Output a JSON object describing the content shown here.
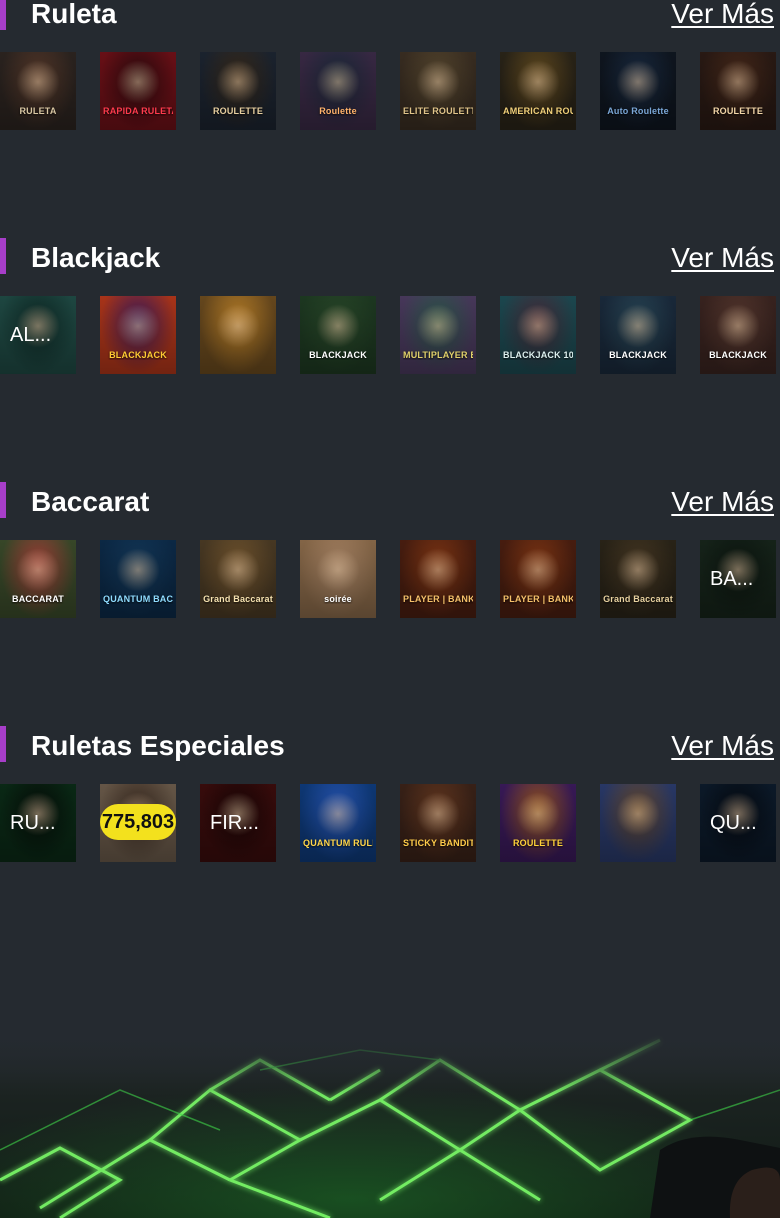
{
  "sections": [
    {
      "title": "Ruleta",
      "see_more": "Ver Más",
      "tiles": [
        {
          "caption": "RULETA",
          "bg": "#2c2420",
          "accent": "#d9c7a3",
          "tint": "#5a3a2a"
        },
        {
          "caption": "RAPIDA RULETA",
          "bg": "#6d1017",
          "accent": "#ff3b4d",
          "tint": "#2a0a0e"
        },
        {
          "caption": "ROULETTE",
          "bg": "#1c2430",
          "accent": "#e7cfa0",
          "tint": "#3a2a18"
        },
        {
          "caption": "Roulette",
          "bg": "#3a2a46",
          "accent": "#ffb36b",
          "tint": "#1a2a3a"
        },
        {
          "caption": "ELITE ROULETTE",
          "bg": "#3a2e22",
          "accent": "#e0c48a",
          "tint": "#5a4a30"
        },
        {
          "caption": "AMERICAN ROULETTE",
          "bg": "#2a2418",
          "accent": "#f1d07a",
          "tint": "#6a5020"
        },
        {
          "caption": "Auto Roulette",
          "bg": "#0f1620",
          "accent": "#7aa6d6",
          "tint": "#1a2c44"
        },
        {
          "caption": "ROULETTE",
          "bg": "#2a1a14",
          "accent": "#f3d6a8",
          "tint": "#4a2a1a"
        }
      ]
    },
    {
      "title": "Blackjack",
      "see_more": "Ver Más",
      "tiles": [
        {
          "caption": "",
          "fallback": "AL...",
          "bg": "#1f4a44",
          "accent": "#8fd6c8",
          "tint": "#0e2a26"
        },
        {
          "caption": "BLACKJACK",
          "bg": "#b0361a",
          "accent": "#ffcc33",
          "tint": "#3a1a60"
        },
        {
          "caption": "",
          "bg": "#6a4a1e",
          "accent": "#f1d08a",
          "tint": "#c98a2a"
        },
        {
          "caption": "BLACKJACK",
          "bg": "#1e3a22",
          "accent": "#ffffff",
          "tint": "#2a4a2a"
        },
        {
          "caption": "MULTIPLAYER BLACKJACK",
          "bg": "#4a3a5e",
          "accent": "#e0d06a",
          "tint": "#2a5a4a"
        },
        {
          "caption": "BLACKJACK 10",
          "bg": "#1d4a52",
          "accent": "#dcefee",
          "tint": "#4a2a3a"
        },
        {
          "caption": "BLACKJACK",
          "bg": "#1a2a3c",
          "accent": "#ffffff",
          "tint": "#2a4a5a"
        },
        {
          "caption": "BLACKJACK",
          "bg": "#3a2420",
          "accent": "#ffffff",
          "tint": "#5a3a30"
        }
      ]
    },
    {
      "title": "Baccarat",
      "see_more": "Ver Más",
      "tiles": [
        {
          "caption": "BACCARAT",
          "bg": "#3a4a2a",
          "accent": "#ffffff",
          "tint": "#b0403a"
        },
        {
          "caption": "QUANTUM BACCARAT",
          "bg": "#0c2a48",
          "accent": "#8fdcff",
          "tint": "#143a5c"
        },
        {
          "caption": "Grand Baccarat",
          "bg": "#4a3a24",
          "accent": "#f6e2b0",
          "tint": "#7a5a30"
        },
        {
          "caption": "soirée",
          "bg": "#8a6a4a",
          "accent": "#ffffff",
          "tint": "#b08a6a"
        },
        {
          "caption": "PLAYER | BANKER",
          "bg": "#4a1e10",
          "accent": "#f5c06a",
          "tint": "#8a3a14"
        },
        {
          "caption": "PLAYER | BANKER",
          "bg": "#4a1e10",
          "accent": "#f5c06a",
          "tint": "#8a3a14"
        },
        {
          "caption": "Grand Baccarat",
          "bg": "#2a2418",
          "accent": "#e8d2a0",
          "tint": "#4a3a24"
        },
        {
          "caption": "",
          "fallback": "BA...",
          "bg": "#16241a",
          "accent": "#6fdc8a",
          "tint": "#0c1610"
        }
      ]
    },
    {
      "title": "Ruletas Especiales",
      "see_more": "Ver Más",
      "tiles": [
        {
          "caption": "",
          "fallback": "RU...",
          "bg": "#0a2a16",
          "accent": "#3ad66a",
          "tint": "#050d08"
        },
        {
          "caption": "",
          "jackpot": "775,803",
          "bg": "#6a5a4a",
          "accent": "#f3e11d",
          "tint": "#3a2a20"
        },
        {
          "caption": "",
          "fallback": "FIR...",
          "bg": "#3a0c0c",
          "accent": "#ff5a3a",
          "tint": "#1a0505"
        },
        {
          "caption": "QUANTUM RULETA",
          "bg": "#0e3a7a",
          "accent": "#ffd54a",
          "tint": "#2a5abf"
        },
        {
          "caption": "STICKY BANDITS",
          "bg": "#3a2218",
          "accent": "#ffcc4a",
          "tint": "#6a3a20"
        },
        {
          "caption": "ROULETTE",
          "bg": "#3a1a5a",
          "accent": "#ffd23a",
          "tint": "#a05a1a"
        },
        {
          "caption": "",
          "bg": "#2a3a6a",
          "accent": "#ffd23a",
          "tint": "#6a4a2a"
        },
        {
          "caption": "",
          "fallback": "QU...",
          "bg": "#0c1a2a",
          "accent": "#7ab6ff",
          "tint": "#050a12"
        }
      ]
    }
  ]
}
